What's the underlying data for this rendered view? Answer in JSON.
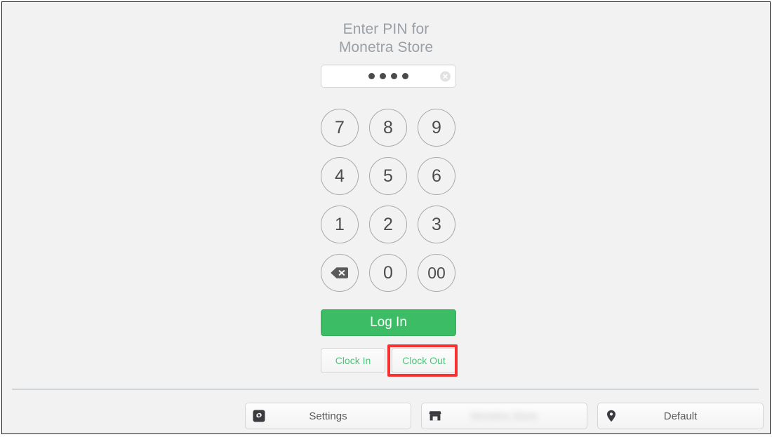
{
  "screen": {
    "background_color": "#f2f2f2",
    "border_color": "#1c1c1c"
  },
  "pin_panel": {
    "title": "Enter PIN for\nMonetra Store",
    "title_color": "#9aa0a6",
    "input": {
      "value": "••••",
      "masked_length": 4,
      "placeholder": "",
      "clear_icon": "close-circle-icon"
    },
    "keypad": [
      {
        "label": "7",
        "value": "7",
        "type": "digit"
      },
      {
        "label": "8",
        "value": "8",
        "type": "digit"
      },
      {
        "label": "9",
        "value": "9",
        "type": "digit"
      },
      {
        "label": "4",
        "value": "4",
        "type": "digit"
      },
      {
        "label": "5",
        "value": "5",
        "type": "digit"
      },
      {
        "label": "6",
        "value": "6",
        "type": "digit"
      },
      {
        "label": "1",
        "value": "1",
        "type": "digit"
      },
      {
        "label": "2",
        "value": "2",
        "type": "digit"
      },
      {
        "label": "3",
        "value": "3",
        "type": "digit"
      },
      {
        "label": "",
        "value": "backspace",
        "type": "backspace",
        "icon": "backspace-icon"
      },
      {
        "label": "0",
        "value": "0",
        "type": "digit"
      },
      {
        "label": "00",
        "value": "00",
        "type": "digit"
      }
    ],
    "login_button": {
      "label": "Log In",
      "background_color": "#3cbc64",
      "text_color": "#ffffff"
    },
    "clock_buttons": [
      {
        "label": "Clock In",
        "text_color": "#4ec479"
      },
      {
        "label": "Clock Out",
        "text_color": "#4ec479",
        "highlighted": true
      }
    ],
    "annotation": {
      "target": "Clock Out",
      "color": "#f7312f",
      "shape": "rectangle"
    }
  },
  "footer": {
    "buttons": [
      {
        "label": "Settings",
        "icon": "gear-icon",
        "blurred": false
      },
      {
        "label": "Monetra Store",
        "icon": "store-icon",
        "blurred": true
      },
      {
        "label": "Default",
        "icon": "location-pin-icon",
        "blurred": false
      }
    ]
  }
}
